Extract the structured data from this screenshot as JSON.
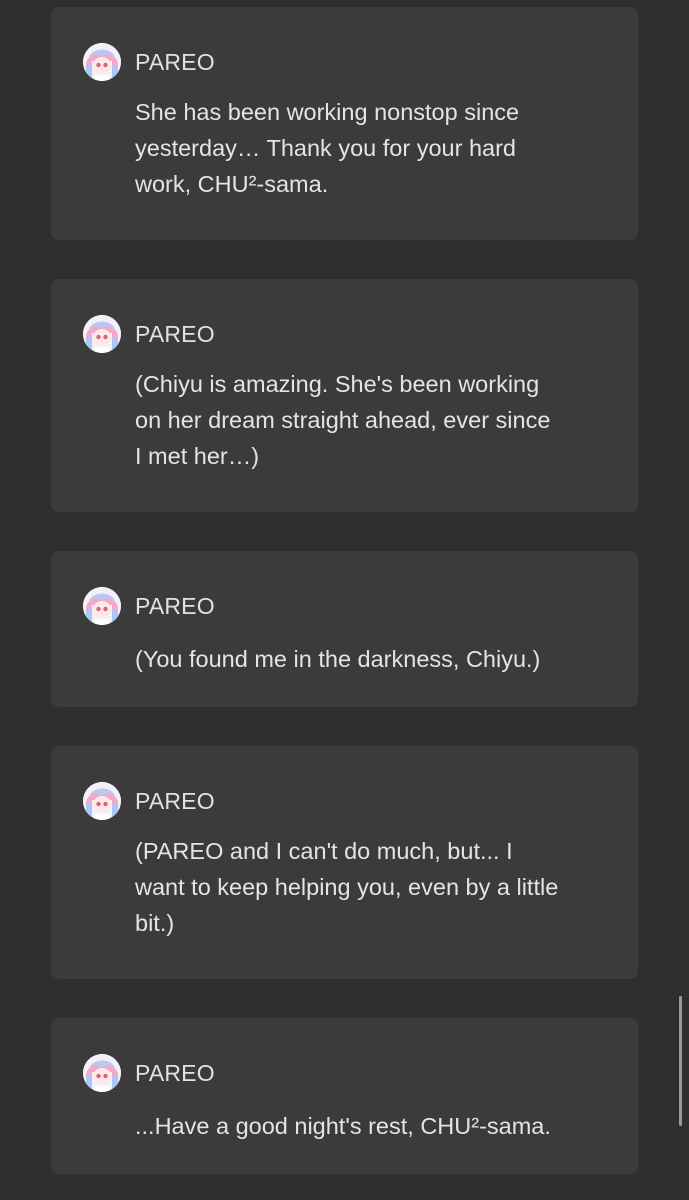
{
  "dialogue": [
    {
      "speaker": "PAREO",
      "text": "She has been working nonstop since\nyesterday… Thank you for your hard\nwork, CHU²-sama."
    },
    {
      "speaker": "PAREO",
      "text": "(Chiyu is amazing. She's been working\non her dream straight ahead, ever since\nI met her…)"
    },
    {
      "speaker": "PAREO",
      "text": "(You found me in the darkness, Chiyu.)"
    },
    {
      "speaker": "PAREO",
      "text": "(PAREO and I can't do much, but... I\nwant to keep helping you, even by a little\nbit.)"
    },
    {
      "speaker": "PAREO",
      "text": "...Have a good night's rest, CHU²-sama."
    }
  ],
  "colors": {
    "background": "#2f2f2f",
    "card": "#3b3b3b",
    "text": "#e4e4e4",
    "avatar_hair_pink": "#f4a7c8",
    "avatar_hair_blue": "#a9c8f2"
  },
  "icons": {
    "avatar": "pareo-avatar-icon"
  }
}
